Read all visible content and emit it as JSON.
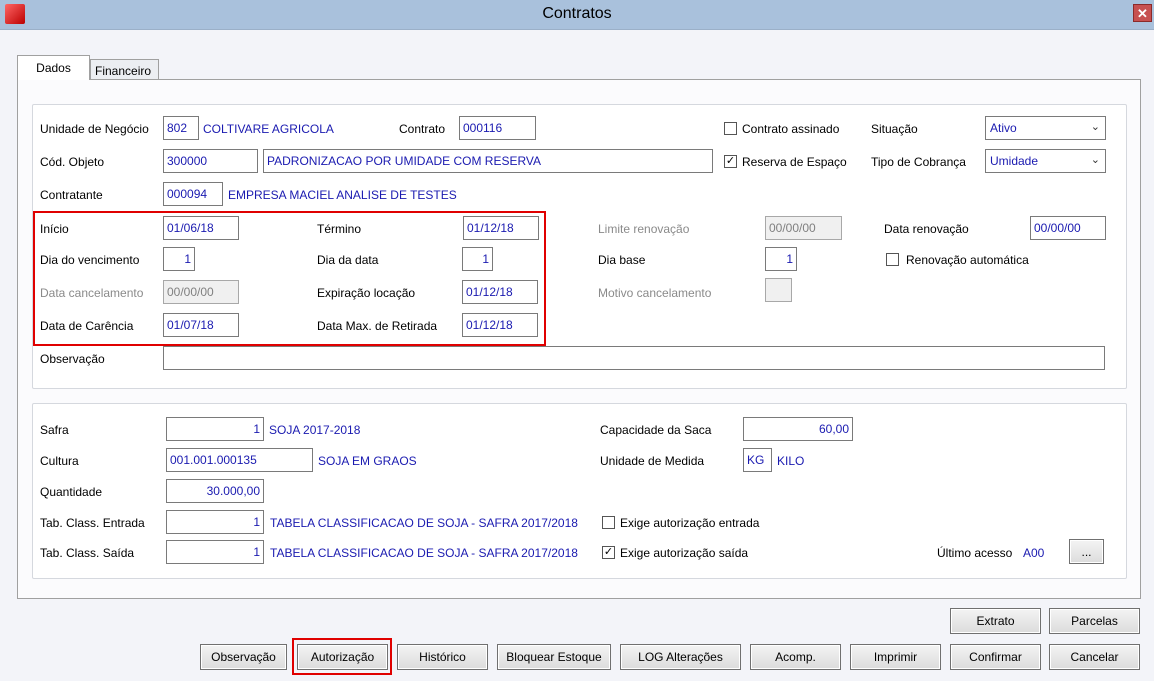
{
  "window": {
    "title": "Contratos",
    "close": "✕"
  },
  "tabs": [
    {
      "label": "Dados"
    },
    {
      "label": "Financeiro"
    }
  ],
  "contract": {
    "unidade_label": "Unidade de Negócio",
    "unidade_code": "802",
    "unidade_name": "COLTIVARE AGRICOLA",
    "contrato_label": "Contrato",
    "contrato": "000116",
    "assinado_label": "Contrato assinado",
    "assinado": false,
    "situacao_label": "Situação",
    "situacao": "Ativo",
    "objeto_label": "Cód. Objeto",
    "objeto_code": "300000",
    "objeto_desc": "PADRONIZACAO POR UMIDADE COM RESERVA",
    "reserva_label": "Reserva de Espaço",
    "reserva": true,
    "cobranca_label": "Tipo de Cobrança",
    "cobranca": "Umidade",
    "contratante_label": "Contratante",
    "contratante_code": "000094",
    "contratante_name": "EMPRESA MACIEL ANALISE DE TESTES",
    "inicio_label": "Início",
    "inicio": "01/06/18",
    "termino_label": "Término",
    "termino": "01/12/18",
    "limite_label": "Limite renovação",
    "limite": "00/00/00",
    "data_renov_label": "Data renovação",
    "data_renov": "00/00/00",
    "dia_venc_label": "Dia do vencimento",
    "dia_venc": "1",
    "dia_data_label": "Dia da data",
    "dia_data": "1",
    "dia_base_label": "Dia base",
    "dia_base": "1",
    "renov_auto_label": "Renovação automática",
    "renov_auto": false,
    "data_cancel_label": "Data cancelamento",
    "data_cancel": "00/00/00",
    "expiracao_label": "Expiração locação",
    "expiracao": "01/12/18",
    "motivo_label": "Motivo cancelamento",
    "carencia_label": "Data de Carência",
    "carencia": "01/07/18",
    "max_retirada_label": "Data Max. de Retirada",
    "max_retirada": "01/12/18",
    "obs_label": "Observação",
    "obs": ""
  },
  "crop": {
    "safra_label": "Safra",
    "safra_code": "1",
    "safra_name": "SOJA 2017-2018",
    "capacidade_label": "Capacidade da Saca",
    "capacidade": "60,00",
    "cultura_label": "Cultura",
    "cultura_code": "001.001.000135",
    "cultura_name": "SOJA EM GRAOS",
    "unidade_med_label": "Unidade de Medida",
    "unidade_med_code": "KG",
    "unidade_med_name": "KILO",
    "quantidade_label": "Quantidade",
    "quantidade": "30.000,00",
    "entrada_label": "Tab. Class. Entrada",
    "entrada_code": "1",
    "entrada_name": "TABELA CLASSIFICACAO DE SOJA - SAFRA 2017/2018",
    "exige_entrada_label": "Exige autorização entrada",
    "exige_entrada": false,
    "saida_label": "Tab. Class. Saída",
    "saida_code": "1",
    "saida_name": "TABELA CLASSIFICACAO DE SOJA - SAFRA 2017/2018",
    "exige_saida_label": "Exige autorização saída",
    "exige_saida": true,
    "ultimo_label": "Último acesso",
    "ultimo": "A00",
    "more": "..."
  },
  "buttons": {
    "extrato": "Extrato",
    "parcelas": "Parcelas",
    "observacao": "Observação",
    "autorizacao": "Autorização",
    "historico": "Histórico",
    "bloquear": "Bloquear Estoque",
    "log": "LOG Alterações",
    "acomp": "Acomp.",
    "imprimir": "Imprimir",
    "confirmar": "Confirmar",
    "cancelar": "Cancelar"
  },
  "colors": {
    "highlight": "#e00000",
    "value_text": "#1a1ab0"
  }
}
